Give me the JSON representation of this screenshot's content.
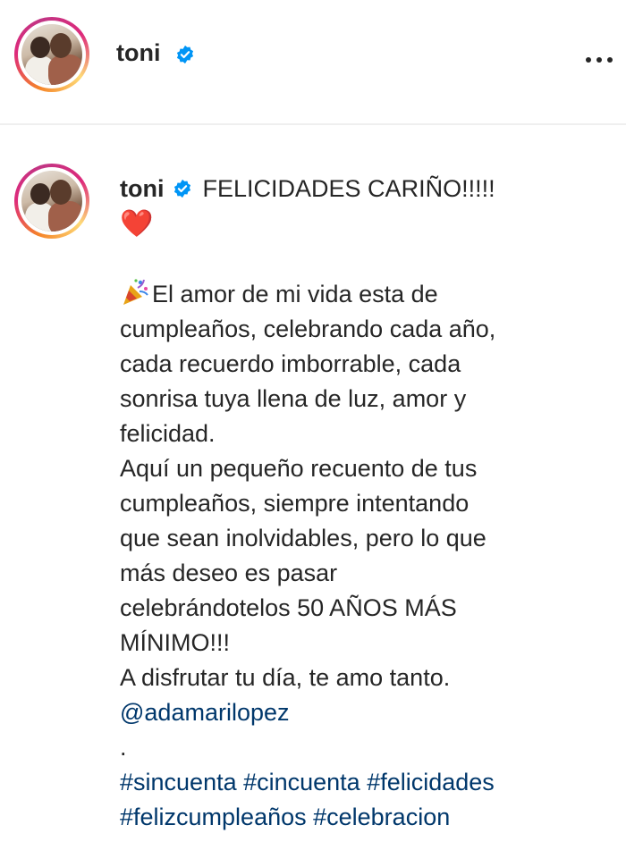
{
  "post": {
    "author": {
      "username": "toni",
      "verified": true,
      "avatar_icon": "profile-photo"
    },
    "more_icon": "more-options-icon"
  },
  "comment": {
    "username": "toni",
    "headline": "FELICIDADES CARIÑO!!!!!",
    "heart": "❤️",
    "lines": [
      "El amor de mi vida esta de",
      "cumpleaños, celebrando cada año,",
      "cada recuerdo imborrable, cada",
      "sonrisa tuya llena de luz, amor y",
      "felicidad.",
      "Aquí un pequeño recuento de tus",
      "cumpleaños, siempre intentando",
      "que sean inolvidables, pero lo que",
      "más deseo es pasar",
      "celebrándotelos 50 AÑOS MÁS",
      "MÍNIMO!!!",
      "A disfrutar tu día, te amo tanto."
    ],
    "mention": "@adamarilopez",
    "dot": ".",
    "hashtags_line1": "#sincuenta #cincuenta #felicidades",
    "hashtags_line2": "#felizcumpleaños #celebracion"
  },
  "colors": {
    "text": "#262626",
    "link": "#00376b",
    "verified_badge": "#0095f6",
    "heart": "#e0202a",
    "divider": "#efefef"
  }
}
